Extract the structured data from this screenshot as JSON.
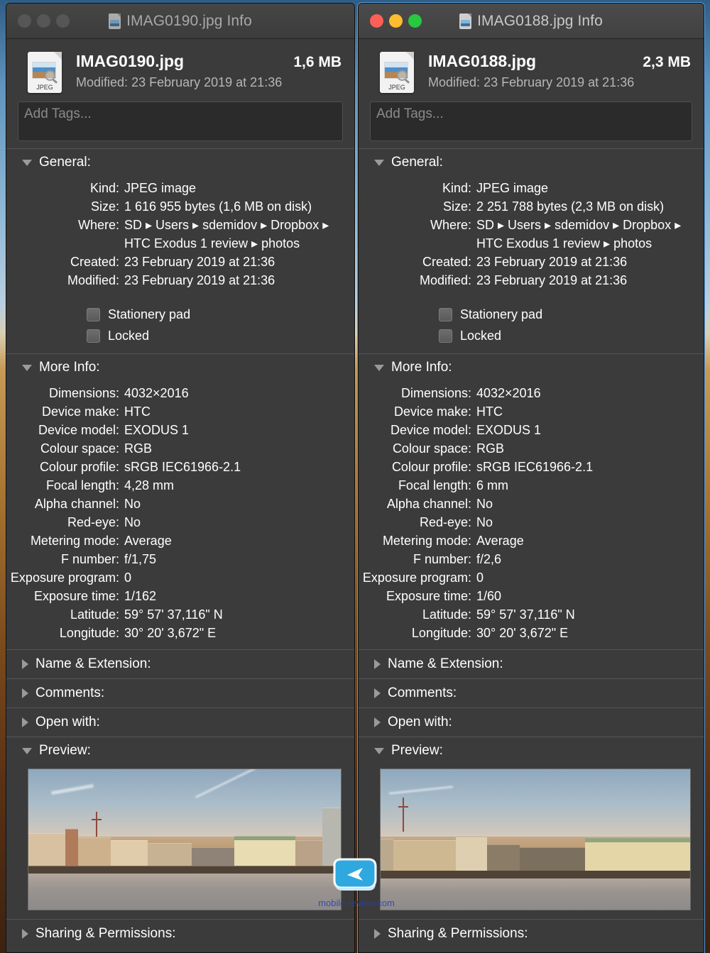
{
  "desktop": {
    "wallpaper_description": "desert-dune-gradient"
  },
  "watermark": {
    "text": "mobile-review.com",
    "icon": "arrow-badge-icon"
  },
  "windows": [
    {
      "id": "left",
      "active": false,
      "titlebar": {
        "title": "IMAG0190.jpg Info",
        "doc_icon": "jpeg-document-icon",
        "close_label": "Close",
        "minimize_label": "Minimize",
        "zoom_label": "Zoom"
      },
      "header": {
        "icon_ext": "JPEG",
        "filename": "IMAG0190.jpg",
        "filesize": "1,6 MB",
        "modified_label": "Modified:",
        "modified_value": "23 February 2019 at 21:36"
      },
      "tags": {
        "placeholder": "Add Tags..."
      },
      "general": {
        "heading": "General:",
        "expanded": true,
        "rows": [
          {
            "label": "Kind:",
            "value": "JPEG image"
          },
          {
            "label": "Size:",
            "value": "1 616 955 bytes (1,6 MB on disk)"
          },
          {
            "label": "Where:",
            "value": "SD ▸ Users ▸ sdemidov ▸ Dropbox ▸ HTC Exodus 1 review ▸ photos"
          },
          {
            "label": "Created:",
            "value": "23 February 2019 at 21:36"
          },
          {
            "label": "Modified:",
            "value": "23 February 2019 at 21:36"
          }
        ],
        "checkboxes": [
          {
            "label": "Stationery pad",
            "checked": false
          },
          {
            "label": "Locked",
            "checked": false
          }
        ]
      },
      "more_info": {
        "heading": "More Info:",
        "expanded": true,
        "rows": [
          {
            "label": "Dimensions:",
            "value": "4032×2016"
          },
          {
            "label": "Device make:",
            "value": "HTC"
          },
          {
            "label": "Device model:",
            "value": "EXODUS 1"
          },
          {
            "label": "Colour space:",
            "value": "RGB"
          },
          {
            "label": "Colour profile:",
            "value": "sRGB IEC61966-2.1"
          },
          {
            "label": "Focal length:",
            "value": "4,28 mm"
          },
          {
            "label": "Alpha channel:",
            "value": "No"
          },
          {
            "label": "Red-eye:",
            "value": "No"
          },
          {
            "label": "Metering mode:",
            "value": "Average"
          },
          {
            "label": "F number:",
            "value": "f/1,75"
          },
          {
            "label": "Exposure program:",
            "value": "0"
          },
          {
            "label": "Exposure time:",
            "value": "1/162"
          },
          {
            "label": "Latitude:",
            "value": "59° 57' 37,116\" N"
          },
          {
            "label": "Longitude:",
            "value": "30° 20' 3,672\" E"
          }
        ]
      },
      "collapsed_sections": [
        {
          "heading": "Name & Extension:"
        },
        {
          "heading": "Comments:"
        },
        {
          "heading": "Open with:"
        }
      ],
      "preview": {
        "heading": "Preview:",
        "expanded": true,
        "image_description": "Panoramic city skyline over a frozen river at sunset"
      },
      "sharing": {
        "heading": "Sharing & Permissions:"
      }
    },
    {
      "id": "right",
      "active": true,
      "titlebar": {
        "title": "IMAG0188.jpg Info",
        "doc_icon": "jpeg-document-icon",
        "close_label": "Close",
        "minimize_label": "Minimize",
        "zoom_label": "Zoom"
      },
      "header": {
        "icon_ext": "JPEG",
        "filename": "IMAG0188.jpg",
        "filesize": "2,3 MB",
        "modified_label": "Modified:",
        "modified_value": "23 February 2019 at 21:36"
      },
      "tags": {
        "placeholder": "Add Tags..."
      },
      "general": {
        "heading": "General:",
        "expanded": true,
        "rows": [
          {
            "label": "Kind:",
            "value": "JPEG image"
          },
          {
            "label": "Size:",
            "value": "2 251 788 bytes (2,3 MB on disk)"
          },
          {
            "label": "Where:",
            "value": "SD ▸ Users ▸ sdemidov ▸ Dropbox ▸ HTC Exodus 1 review ▸ photos"
          },
          {
            "label": "Created:",
            "value": "23 February 2019 at 21:36"
          },
          {
            "label": "Modified:",
            "value": "23 February 2019 at 21:36"
          }
        ],
        "checkboxes": [
          {
            "label": "Stationery pad",
            "checked": false
          },
          {
            "label": "Locked",
            "checked": false
          }
        ]
      },
      "more_info": {
        "heading": "More Info:",
        "expanded": true,
        "rows": [
          {
            "label": "Dimensions:",
            "value": "4032×2016"
          },
          {
            "label": "Device make:",
            "value": "HTC"
          },
          {
            "label": "Device model:",
            "value": "EXODUS 1"
          },
          {
            "label": "Colour space:",
            "value": "RGB"
          },
          {
            "label": "Colour profile:",
            "value": "sRGB IEC61966-2.1"
          },
          {
            "label": "Focal length:",
            "value": "6 mm"
          },
          {
            "label": "Alpha channel:",
            "value": "No"
          },
          {
            "label": "Red-eye:",
            "value": "No"
          },
          {
            "label": "Metering mode:",
            "value": "Average"
          },
          {
            "label": "F number:",
            "value": "f/2,6"
          },
          {
            "label": "Exposure program:",
            "value": "0"
          },
          {
            "label": "Exposure time:",
            "value": "1/60"
          },
          {
            "label": "Latitude:",
            "value": "59° 57' 37,116\" N"
          },
          {
            "label": "Longitude:",
            "value": "30° 20' 3,672\" E"
          }
        ]
      },
      "collapsed_sections": [
        {
          "heading": "Name & Extension:"
        },
        {
          "heading": "Comments:"
        },
        {
          "heading": "Open with:"
        }
      ],
      "preview": {
        "heading": "Preview:",
        "expanded": true,
        "image_description": "Panoramic city skyline over a river embankment at sunset"
      },
      "sharing": {
        "heading": "Sharing & Permissions:"
      }
    }
  ]
}
